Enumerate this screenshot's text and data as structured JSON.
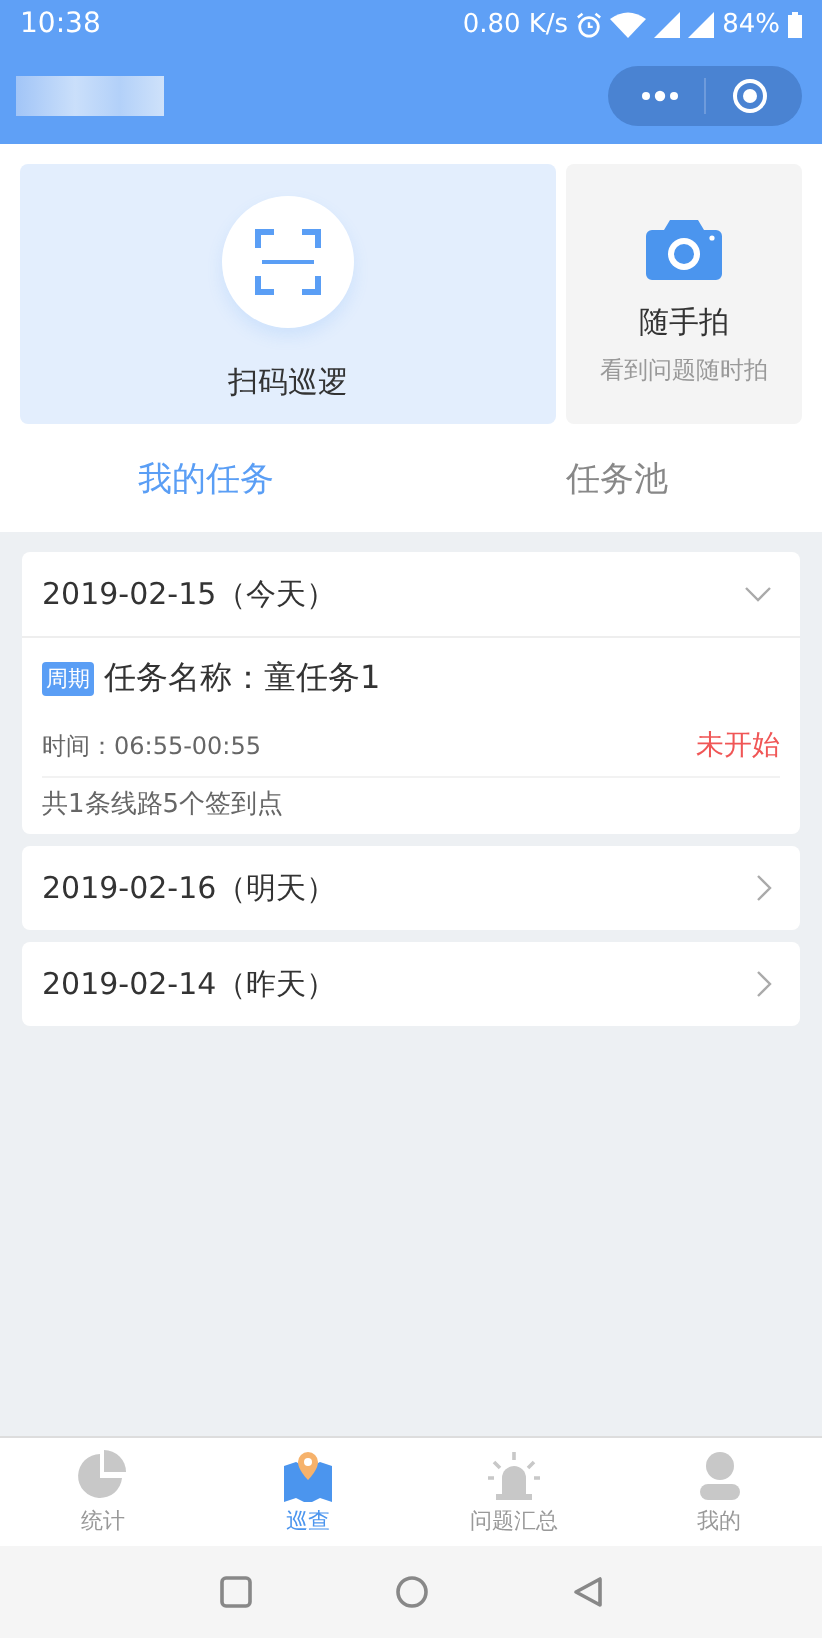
{
  "status_bar": {
    "time": "10:38",
    "speed": "0.80 K/s",
    "battery": "84%"
  },
  "actions": [
    {
      "kind": "scan",
      "label": "扫码巡逻"
    },
    {
      "kind": "photo",
      "label": "随手拍",
      "subtitle": "看到问题随时拍"
    }
  ],
  "tabs": [
    {
      "label": "我的任务",
      "selected": true
    },
    {
      "label": "任务池",
      "selected": false
    }
  ],
  "days": [
    {
      "date": "2019-02-15（今天）",
      "expanded": true,
      "tasks": [
        {
          "tag": "周期",
          "name": "任务名称：童任务1",
          "time": "时间：06:55-00:55",
          "status": "未开始",
          "summary": "共1条线路5个签到点"
        }
      ]
    },
    {
      "date": "2019-02-16（明天）",
      "expanded": false
    },
    {
      "date": "2019-02-14（昨天）",
      "expanded": false
    }
  ],
  "bottom_nav": [
    {
      "kind": "stats",
      "label": "统计",
      "selected": false
    },
    {
      "kind": "map",
      "label": "巡查",
      "selected": true
    },
    {
      "kind": "alarm",
      "label": "问题汇总",
      "selected": false
    },
    {
      "kind": "user",
      "label": "我的",
      "selected": false
    }
  ]
}
